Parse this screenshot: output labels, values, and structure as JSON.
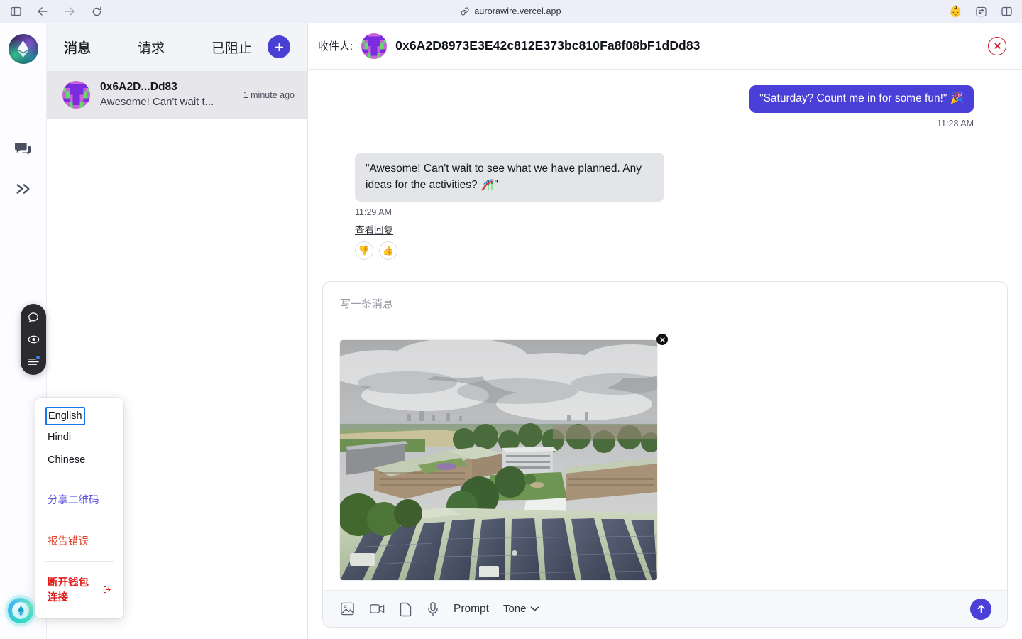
{
  "browser": {
    "url": "aurorawire.vercel.app",
    "nav": {
      "sidebar_toggle": "sidebar-toggle",
      "back": "back",
      "forward": "forward",
      "reload": "reload"
    },
    "right_icons": [
      "profile-avatar",
      "extensions-settings",
      "split-view"
    ],
    "profile_emoji": "👶"
  },
  "rail": {
    "logo_name": "aurorawire-logo",
    "icons": [
      "chat-bubbles-icon",
      "double-chevron-right-icon"
    ],
    "widget_icons": [
      "comment-icon",
      "eye-icon",
      "list-icon"
    ],
    "wallet_label": "wallet-orb"
  },
  "list": {
    "tabs": [
      {
        "label": "消息",
        "active": true
      },
      {
        "label": "请求",
        "active": false
      },
      {
        "label": "已阻止",
        "active": false
      }
    ],
    "add_label": "+",
    "conversations": [
      {
        "name": "0x6A2D...Dd83",
        "preview": "Awesome! Can't wait t...",
        "time": "1 minute ago"
      }
    ]
  },
  "chat": {
    "recipient_label": "收件人:",
    "peer_address": "0x6A2D8973E3E42c812E373bc810Fa8f08bF1dDd83",
    "close_label": "✕",
    "messages": [
      {
        "direction": "out",
        "text": "\"Saturday? Count me in for some fun!\" 🎉",
        "time": "11:28 AM"
      },
      {
        "direction": "in",
        "text": "\"Awesome! Can't wait to see what we have planned. Any ideas for the activities? 🎢\"",
        "time": "11:29 AM",
        "see_replies": "查看回复",
        "reactions": [
          "👎",
          "👍"
        ]
      }
    ]
  },
  "composer": {
    "placeholder": "写一条消息",
    "value": "",
    "attachment": {
      "name": "aerial-campus-solar-panels-photo",
      "remove_label": "✕"
    },
    "tools": [
      "image-icon",
      "video-icon",
      "file-icon",
      "microphone-icon"
    ],
    "prompt_label": "Prompt",
    "tone_label": "Tone",
    "send_label": "send"
  },
  "menu": {
    "languages": [
      {
        "label": "English",
        "focused": true
      },
      {
        "label": "Hindi",
        "focused": false
      },
      {
        "label": "Chinese",
        "focused": false
      }
    ],
    "share_qr": "分享二维码",
    "report_bug": "报告错误",
    "disconnect": "断开钱包连接"
  },
  "colors": {
    "accent": "#4a3fd6",
    "danger": "#e01b1b",
    "link": "#5b52e0",
    "warn": "#e0422e",
    "chrome_bg": "#eceef8"
  }
}
